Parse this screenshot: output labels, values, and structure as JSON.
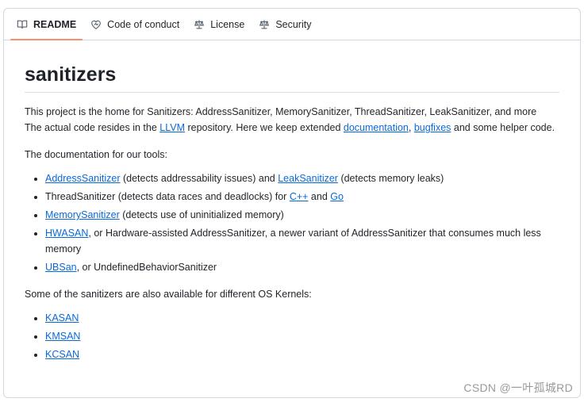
{
  "tabs": [
    {
      "label": "README",
      "icon": "book-icon",
      "active": true
    },
    {
      "label": "Code of conduct",
      "icon": "heart-icon"
    },
    {
      "label": "License",
      "icon": "law-icon"
    },
    {
      "label": "Security",
      "icon": "law-icon"
    }
  ],
  "readme": {
    "title": "sanitizers",
    "intro": {
      "t1": "This project is the home for Sanitizers: AddressSanitizer, MemorySanitizer, ThreadSanitizer, LeakSanitizer, and more",
      "t2": "The actual code resides in the ",
      "llvm": "LLVM",
      "t3": " repository. Here we keep extended ",
      "documentation": "documentation",
      "t4": ", ",
      "bugfixes": "bugfixes",
      "t5": " and some helper code."
    },
    "tools_heading": "The documentation for our tools:",
    "tools": {
      "asan": {
        "link": "AddressSanitizer",
        "t1": " (detects addressability issues) and ",
        "link2": "LeakSanitizer",
        "t2": " (detects memory leaks)"
      },
      "tsan": {
        "t1": "ThreadSanitizer (detects data races and deadlocks) for ",
        "link": "C++",
        "t2": " and ",
        "link2": "Go"
      },
      "msan": {
        "link": "MemorySanitizer",
        "t1": " (detects use of uninitialized memory)"
      },
      "hwasan": {
        "link": "HWASAN",
        "t1": ", or Hardware-assisted AddressSanitizer, a newer variant of AddressSanitizer that consumes much less memory"
      },
      "ubsan": {
        "link": "UBSan",
        "t1": ", or UndefinedBehaviorSanitizer"
      }
    },
    "kernels_heading": "Some of the sanitizers are also available for different OS Kernels:",
    "kernels": [
      "KASAN",
      "KMSAN",
      "KCSAN"
    ]
  },
  "watermark": "CSDN @一叶孤城RD"
}
